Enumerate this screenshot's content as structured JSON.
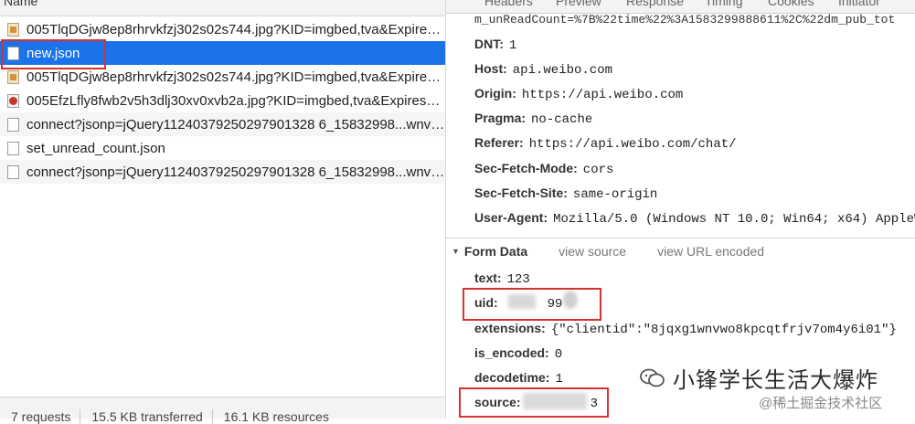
{
  "list": {
    "header": "Name",
    "rows": [
      {
        "name": "005TlqDGjw8ep8rhrvkfzj302s02s744.jpg?KID=imgbed,tva&Expires...",
        "icon": "image-file-icon"
      },
      {
        "name": "new.json",
        "icon": "document-icon"
      },
      {
        "name": "005TlqDGjw8ep8rhrvkfzj302s02s744.jpg?KID=imgbed,tva&Expires...",
        "icon": "image-file-icon"
      },
      {
        "name": "005EfzLfly8fwb2v5h3dlj30xv0xvb2a.jpg?KID=imgbed,tva&Expires=...",
        "icon": "image-file-icon"
      },
      {
        "name": "connect?jsonp=jQuery11240379250297901328 6_15832998...wnvw...",
        "icon": "document-icon"
      },
      {
        "name": "set_unread_count.json",
        "icon": "document-icon"
      },
      {
        "name": "connect?jsonp=jQuery11240379250297901328 6_15832998...wnvw...",
        "icon": "document-icon"
      }
    ]
  },
  "status": {
    "requests": "7 requests",
    "transferred": "15.5 KB transferred",
    "resources": "16.1 KB resources"
  },
  "tabs": [
    "Headers",
    "Preview",
    "Response",
    "Timing",
    "Cookies",
    "Initiator"
  ],
  "headers_partial": "m_unReadCount=%7B%22time%22%3A1583299888611%2C%22dm_pub_tot",
  "request_headers": [
    {
      "key": "DNT:",
      "value": "1"
    },
    {
      "key": "Host:",
      "value": "api.weibo.com"
    },
    {
      "key": "Origin:",
      "value": "https://api.weibo.com"
    },
    {
      "key": "Pragma:",
      "value": "no-cache"
    },
    {
      "key": "Referer:",
      "value": "https://api.weibo.com/chat/"
    },
    {
      "key": "Sec-Fetch-Mode:",
      "value": "cors"
    },
    {
      "key": "Sec-Fetch-Site:",
      "value": "same-origin"
    },
    {
      "key": "User-Agent:",
      "value": "Mozilla/5.0 (Windows NT 10.0; Win64; x64) AppleW"
    }
  ],
  "form_data": {
    "title": "Form Data",
    "view_source": "view source",
    "view_url_encoded": "view URL encoded",
    "fields": [
      {
        "key": "text:",
        "value": "123"
      },
      {
        "key": "uid:",
        "value": "99"
      },
      {
        "key": "extensions:",
        "value": "{\"clientid\":\"8jqxg1wnvwo8kpcqtfrjv7om4y6i01\"}"
      },
      {
        "key": "is_encoded:",
        "value": "0"
      },
      {
        "key": "decodetime:",
        "value": "1"
      },
      {
        "key": "source:",
        "value": "3"
      }
    ]
  },
  "watermark": {
    "title": "小锋学长生活大爆炸",
    "subtitle": "@稀土掘金技术社区"
  },
  "colors": {
    "selection": "#1a73e8",
    "highlight_box": "#d93030"
  }
}
